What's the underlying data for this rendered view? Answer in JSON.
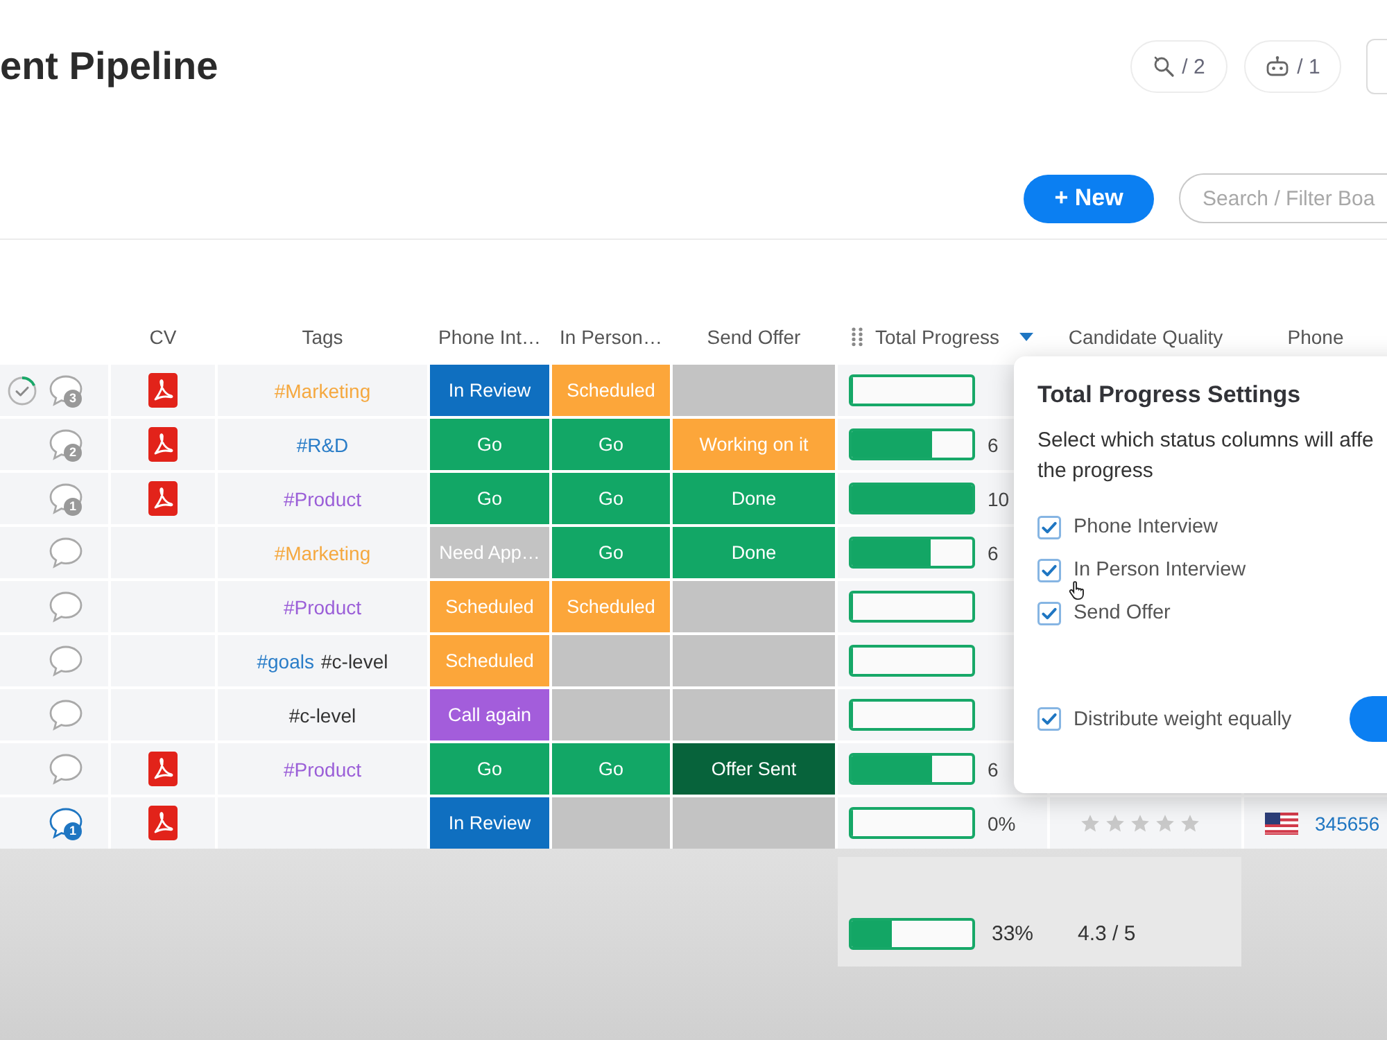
{
  "board": {
    "title": "ent Pipeline"
  },
  "toolbar": {
    "counters": [
      {
        "kind": "integrations",
        "label": "/ 2"
      },
      {
        "kind": "automations",
        "label": "/ 1"
      }
    ],
    "new_button": "+ New",
    "search": {
      "placeholder": "Search / Filter Boa"
    }
  },
  "table": {
    "columns": [
      {
        "label": "CV",
        "menu_open": false
      },
      {
        "label": "Tags",
        "menu_open": false
      },
      {
        "label": "Phone Int…",
        "menu_open": false
      },
      {
        "label": "In Person…",
        "menu_open": false
      },
      {
        "label": "Send Offer",
        "menu_open": false
      },
      {
        "label": "Total Progress",
        "menu_open": true
      },
      {
        "label": "Candidate Quality",
        "menu_open": false
      },
      {
        "label": "Phone",
        "menu_open": false
      }
    ],
    "rows": [
      {
        "check_ring": true,
        "comments": {
          "count": "3",
          "unread": false
        },
        "cv": true,
        "tags": [
          {
            "text": "#Marketing",
            "color": "#f5a83f"
          }
        ],
        "statuses": [
          {
            "label": "In Review",
            "color": "#0f6fc0"
          },
          {
            "label": "Scheduled",
            "color": "#fca63a"
          },
          {
            "color": "#c3c3c3"
          }
        ],
        "progress": {
          "level": 0
        }
      },
      {
        "check_ring": false,
        "comments": {
          "count": "2",
          "unread": false
        },
        "cv": true,
        "tags": [
          {
            "text": "#R&D",
            "color": "#2a7dc8"
          }
        ],
        "statuses": [
          {
            "label": "Go",
            "color": "#12a766"
          },
          {
            "label": "Go",
            "color": "#12a766"
          },
          {
            "label": "Working on it",
            "color": "#fca63a"
          }
        ],
        "progress": {
          "level": 0.67,
          "percent": "6"
        }
      },
      {
        "check_ring": false,
        "comments": {
          "count": "1",
          "unread": false
        },
        "cv": true,
        "tags": [
          {
            "text": "#Product",
            "color": "#9b5fd8"
          }
        ],
        "statuses": [
          {
            "label": "Go",
            "color": "#12a766"
          },
          {
            "label": "Go",
            "color": "#12a766"
          },
          {
            "label": "Done",
            "color": "#12a766"
          }
        ],
        "progress": {
          "level": 1,
          "percent": "10"
        }
      },
      {
        "check_ring": false,
        "comments": {
          "unread": false
        },
        "cv": false,
        "tags": [
          {
            "text": "#Marketing",
            "color": "#f5a83f"
          }
        ],
        "statuses": [
          {
            "label": "Need App…",
            "color": "#c3c3c3"
          },
          {
            "label": "Go",
            "color": "#12a766"
          },
          {
            "label": "Done",
            "color": "#12a766"
          }
        ],
        "progress": {
          "level": 0.66,
          "percent": "6"
        }
      },
      {
        "check_ring": false,
        "comments": {
          "unread": false
        },
        "cv": false,
        "tags": [
          {
            "text": "#Product",
            "color": "#9b5fd8"
          }
        ],
        "statuses": [
          {
            "label": "Scheduled",
            "color": "#fca63a"
          },
          {
            "label": "Scheduled",
            "color": "#fca63a"
          },
          {
            "color": "#c3c3c3"
          }
        ],
        "progress": {
          "level": 0
        }
      },
      {
        "check_ring": false,
        "comments": {
          "unread": false
        },
        "cv": false,
        "tags": [
          {
            "text": "#goals",
            "color": "#2a7dc8"
          },
          {
            "text": "#c-level",
            "color": "#333333"
          }
        ],
        "statuses": [
          {
            "label": "Scheduled",
            "color": "#fca63a"
          },
          {
            "color": "#c3c3c3"
          },
          {
            "color": "#c3c3c3"
          }
        ],
        "progress": {
          "level": 0
        }
      },
      {
        "check_ring": false,
        "comments": {
          "unread": false
        },
        "cv": false,
        "tags": [
          {
            "text": "#c-level",
            "color": "#333333"
          }
        ],
        "statuses": [
          {
            "label": "Call again",
            "color": "#a35ddb"
          },
          {
            "color": "#c3c3c3"
          },
          {
            "color": "#c3c3c3"
          }
        ],
        "progress": {
          "level": 0
        }
      },
      {
        "check_ring": false,
        "comments": {
          "unread": false
        },
        "cv": true,
        "tags": [
          {
            "text": "#Product",
            "color": "#9b5fd8"
          }
        ],
        "statuses": [
          {
            "label": "Go",
            "color": "#12a766"
          },
          {
            "label": "Go",
            "color": "#12a766"
          },
          {
            "label": "Offer Sent",
            "color": "#07633b"
          }
        ],
        "progress": {
          "level": 0.67,
          "percent": "6"
        }
      },
      {
        "check_ring": false,
        "comments": {
          "count": "1",
          "unread": true
        },
        "cv": true,
        "statuses": [
          {
            "label": "In Review",
            "color": "#0f6fc0"
          },
          {
            "color": "#c3c3c3"
          },
          {
            "color": "#c3c3c3"
          }
        ],
        "progress": {
          "level": 0,
          "percent": "0%"
        },
        "quality": {
          "stars": 0
        },
        "phone": {
          "number": "345656"
        }
      }
    ],
    "summary": {
      "progress": {
        "level": 0.33,
        "percent": "33%"
      },
      "quality": "4.3 / 5"
    }
  },
  "popup": {
    "title": "Total Progress Settings",
    "description": [
      "Select which status columns will affe",
      "the progress"
    ],
    "options": [
      {
        "label": "Phone Interview",
        "checked": true
      },
      {
        "label": "In Person Interview",
        "checked": true
      },
      {
        "label": "Send Offer",
        "checked": true
      }
    ],
    "distribute": {
      "label": "Distribute weight equally",
      "checked": true
    }
  }
}
